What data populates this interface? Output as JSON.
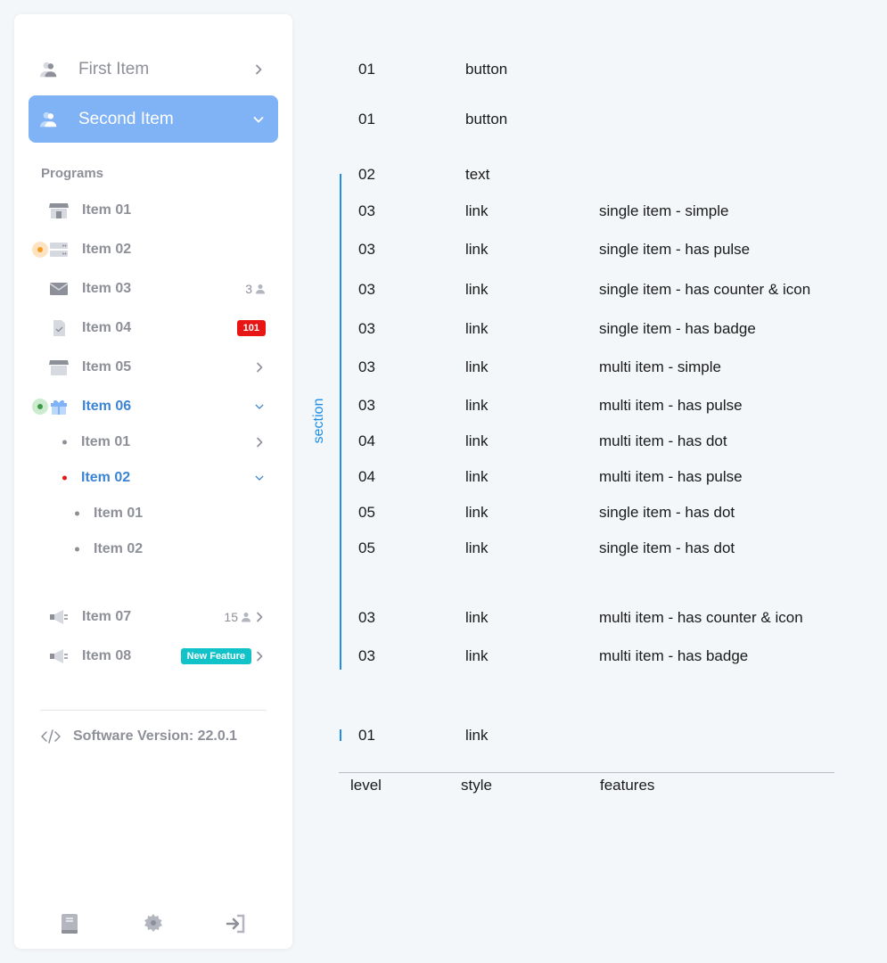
{
  "sidebar": {
    "top_buttons": [
      {
        "label": "First Item"
      },
      {
        "label": "Second Item"
      }
    ],
    "programs_label": "Programs",
    "items": [
      {
        "label": "Item 01"
      },
      {
        "label": "Item 02"
      },
      {
        "label": "Item 03",
        "counter": "3"
      },
      {
        "label": "Item 04",
        "badge": "101"
      },
      {
        "label": "Item 05"
      },
      {
        "label": "Item 06"
      },
      {
        "label": "Item 07",
        "counter": "15"
      },
      {
        "label": "Item 08",
        "badge": "New Feature"
      }
    ],
    "sub_items": [
      {
        "label": "Item 01"
      },
      {
        "label": "Item 02"
      }
    ],
    "sub_sub_items": [
      {
        "label": "Item 01"
      },
      {
        "label": "Item 02"
      }
    ],
    "version": "Software Version: 22.0.1",
    "footer_icons": [
      "book-icon",
      "settings-gear-icon",
      "sign-out-icon"
    ]
  },
  "colors": {
    "accent": "#7fb3f6",
    "active_text": "#3c84d6",
    "badge_red": "#e81515",
    "badge_teal": "#11c2c9",
    "section": "#1e8ee8",
    "pulse_orange": "#f59a23",
    "pulse_green": "#3a9b45"
  },
  "table": {
    "section_label": "section",
    "headers": {
      "level": "level",
      "style": "style",
      "features": "features"
    },
    "rows": [
      {
        "level": "01",
        "style": "button",
        "features": ""
      },
      {
        "level": "01",
        "style": "button",
        "features": ""
      },
      {
        "level": "02",
        "style": "text",
        "features": ""
      },
      {
        "level": "03",
        "style": "link",
        "features": "single item - simple"
      },
      {
        "level": "03",
        "style": "link",
        "features": "single item - has pulse"
      },
      {
        "level": "03",
        "style": "link",
        "features": "single item - has counter & icon"
      },
      {
        "level": "03",
        "style": "link",
        "features": "single item - has badge"
      },
      {
        "level": "03",
        "style": "link",
        "features": "multi item - simple"
      },
      {
        "level": "03",
        "style": "link",
        "features": "multi item - has pulse"
      },
      {
        "level": "04",
        "style": "link",
        "features": "multi item - has dot"
      },
      {
        "level": "04",
        "style": "link",
        "features": "multi item - has pulse"
      },
      {
        "level": "05",
        "style": "link",
        "features": "single item - has dot"
      },
      {
        "level": "05",
        "style": "link",
        "features": "single item - has dot"
      },
      {
        "level": "03",
        "style": "link",
        "features": "multi item - has counter & icon"
      },
      {
        "level": "03",
        "style": "link",
        "features": "multi item - has badge"
      },
      {
        "level": "01",
        "style": "link",
        "features": ""
      }
    ]
  }
}
